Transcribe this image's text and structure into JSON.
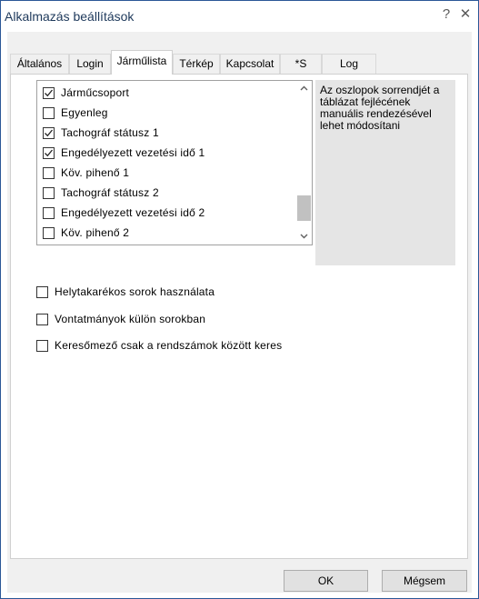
{
  "window": {
    "title": "Alkalmazás beállítások",
    "help_glyph": "?",
    "close_glyph": "✕"
  },
  "tabs": [
    {
      "label": "Általános",
      "active": false
    },
    {
      "label": "Login",
      "active": false
    },
    {
      "label": "Járműlista",
      "active": true
    },
    {
      "label": "Térkép",
      "active": false
    },
    {
      "label": "Kapcsolat",
      "active": false
    },
    {
      "label": "*S",
      "active": false
    },
    {
      "label": "Log",
      "active": false
    }
  ],
  "column_list": {
    "items": [
      {
        "label": "Járműcsoport",
        "checked": true
      },
      {
        "label": "Egyenleg",
        "checked": false
      },
      {
        "label": "Tachográf státusz 1",
        "checked": true
      },
      {
        "label": "Engedélyezett vezetési idő 1",
        "checked": true
      },
      {
        "label": "Köv. pihenő 1",
        "checked": false
      },
      {
        "label": "Tachográf státusz 2",
        "checked": false
      },
      {
        "label": "Engedélyezett vezetési idő 2",
        "checked": false
      },
      {
        "label": "Köv. pihenő 2",
        "checked": false
      }
    ],
    "scroll_up_icon": "chevron-up-icon",
    "scroll_down_icon": "chevron-down-icon"
  },
  "hint": "Az oszlopok sorrendjét a táblázat fejlécének manuális rendezésével lehet módosítani",
  "options": [
    {
      "label": "Helytakarékos sorok használata",
      "checked": false
    },
    {
      "label": "Vontatmányok külön sorokban",
      "checked": false
    },
    {
      "label": "Keresőmező csak a rendszámok között keres",
      "checked": false
    }
  ],
  "buttons": {
    "ok": "OK",
    "cancel": "Mégsem"
  },
  "colors": {
    "window_border": "#2b5797",
    "title_text": "#1e395b",
    "client_bg": "#f0f0f0",
    "hint_bg": "#e5e5e5",
    "button_bg": "#e1e1e1"
  }
}
